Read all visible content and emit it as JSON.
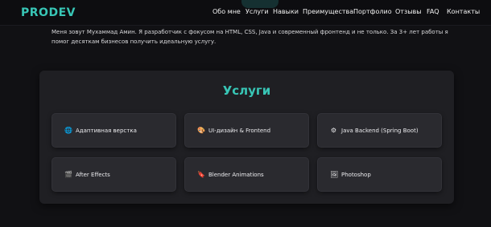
{
  "nav": {
    "logo": "PRODEV",
    "links": [
      "Обо мне",
      "Услуги",
      "Навыки",
      "Преимущества",
      "Портфолио",
      "Отзывы",
      "FAQ",
      "Контакты"
    ]
  },
  "about": {
    "text": "Меня зовут Мухаммад Амин. Я разработчик с фокусом на HTML, CSS, Java и современный фронтенд и не только. За 3+ лет работы я помог десяткам бизнесов получить идеальную услугу."
  },
  "services": {
    "title": "Услуги",
    "items": [
      {
        "label": "Адаптивная верстка",
        "icon": "🌐",
        "icon_name": "globe-icon"
      },
      {
        "label": "UI-дизайн & Frontend",
        "icon": "🎨",
        "icon_name": "palette-icon"
      },
      {
        "label": "Java Backend (Spring Boot)",
        "icon": "⚙",
        "icon_name": "gear-icon"
      },
      {
        "label": "After Effects",
        "icon": "🎬",
        "icon_name": "film-icon"
      },
      {
        "label": "Blender Animations",
        "icon": "🔖",
        "icon_name": "blender-icon"
      },
      {
        "label": "Photoshop",
        "icon": "🖼",
        "icon_name": "picture-icon"
      }
    ]
  },
  "colors": {
    "accent": "#38c6b6",
    "background": "#111114",
    "panel": "#1f1f23",
    "card": "#2a2a2f"
  }
}
